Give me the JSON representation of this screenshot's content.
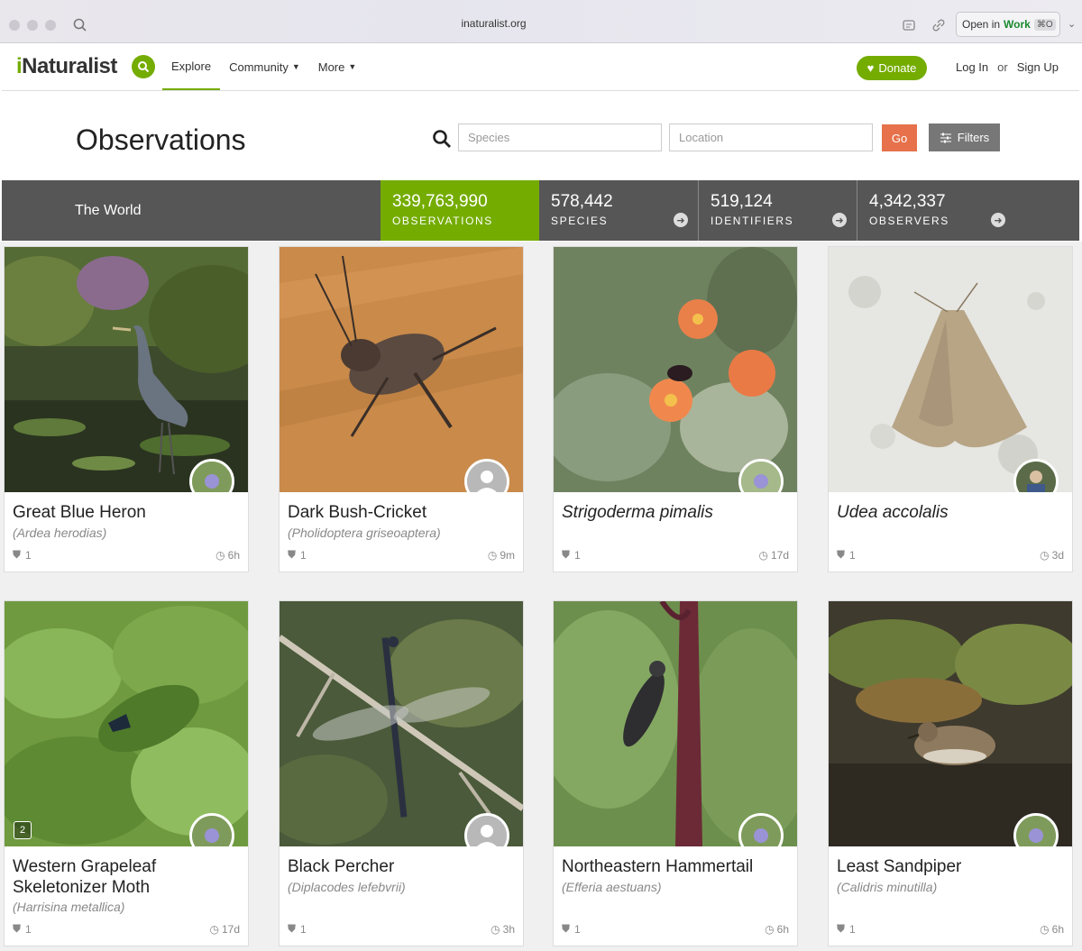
{
  "browser": {
    "url": "inaturalist.org",
    "open_in_prefix": "Open in",
    "open_in_app": "Work",
    "shortcut": "⌘O"
  },
  "header": {
    "logo_i": "i",
    "logo_rest": "Naturalist",
    "nav": [
      {
        "label": "Explore"
      },
      {
        "label": "Community"
      },
      {
        "label": "More"
      }
    ],
    "donate_label": "Donate",
    "login_label": "Log In",
    "or_label": "or",
    "signup_label": "Sign Up",
    "accent": "#74ac00"
  },
  "title_row": {
    "title": "Observations",
    "species_placeholder": "Species",
    "location_placeholder": "Location",
    "go_label": "Go",
    "filters_label": "Filters"
  },
  "stats": {
    "place": "The World",
    "items": [
      {
        "number": "339,763,990",
        "label": "OBSERVATIONS"
      },
      {
        "number": "578,442",
        "label": "SPECIES"
      },
      {
        "number": "519,124",
        "label": "IDENTIFIERS"
      },
      {
        "number": "4,342,337",
        "label": "OBSERVERS"
      }
    ]
  },
  "observations": [
    {
      "name": "Great Blue Heron",
      "sci": "(Ardea herodias)",
      "ids": "1",
      "time": "6h"
    },
    {
      "name": "Dark Bush-Cricket",
      "sci": "(Pholidoptera griseoaptera)",
      "ids": "1",
      "time": "9m"
    },
    {
      "name": "Strigoderma pimalis",
      "sci": "",
      "ids": "1",
      "time": "17d"
    },
    {
      "name": "Udea accolalis",
      "sci": "",
      "ids": "1",
      "time": "3d"
    },
    {
      "name": "Western Grapeleaf Skeletonizer Moth",
      "sci": "(Harrisina metallica)",
      "ids": "1",
      "time": "17d",
      "photo_count": "2"
    },
    {
      "name": "Black Percher",
      "sci": "(Diplacodes lefebvrii)",
      "ids": "1",
      "time": "3h"
    },
    {
      "name": "Northeastern Hammertail",
      "sci": "(Efferia aestuans)",
      "ids": "1",
      "time": "6h"
    },
    {
      "name": "Least Sandpiper",
      "sci": "(Calidris minutilla)",
      "ids": "1",
      "time": "6h"
    }
  ]
}
